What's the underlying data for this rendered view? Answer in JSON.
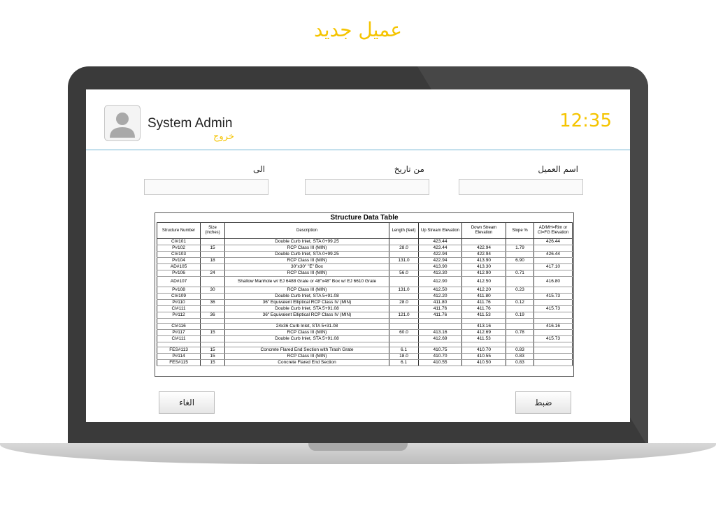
{
  "page_title": "عميل جديد",
  "header": {
    "username": "System Admin",
    "logout_label": "خروج",
    "time": "12:35"
  },
  "form": {
    "customer_name_label": "اسم العميل",
    "from_date_label": "من تاريخ",
    "to_label": "الى",
    "customer_name_value": "",
    "from_date_value": "",
    "to_value": ""
  },
  "document": {
    "title": "Structure Data Table",
    "columns": [
      "Structure Number",
      "Size (inches)",
      "Description",
      "Length (feet)",
      "Up Stream Elevation",
      "Down Stream Elevation",
      "Slope %",
      "AD/MH=Rim or CI=FG Elevation"
    ],
    "rows": [
      [
        "CI#101",
        "",
        "Double Curb Inlet, STA 0+99.25",
        "",
        "423.44",
        "",
        "",
        "426.44"
      ],
      [
        "P#102",
        "15",
        "RCP Class III (MIN)",
        "28.0",
        "423.44",
        "422.94",
        "1.79",
        ""
      ],
      [
        "CI#103",
        "",
        "Double Curb Inlet, STA 0+99.25",
        "",
        "422.94",
        "422.94",
        "",
        "426.44"
      ],
      [
        "P#104",
        "18",
        "RCP Class III (MIN)",
        "131.0",
        "422.94",
        "413.90",
        "6.90",
        ""
      ],
      [
        "AD#105",
        "",
        "30\"x30\" \"E\" Box",
        "",
        "413.90",
        "413.30",
        "",
        "417.10"
      ],
      [
        "P#106",
        "24",
        "RCP Class III (MIN)",
        "56.0",
        "413.30",
        "412.90",
        "0.71",
        ""
      ],
      [
        "AD#107",
        "",
        "Shallow Manhole w/ EJ 6488 Grate or 48\"x48\" Box w/ EJ 6610 Grate",
        "",
        "412.90",
        "412.50",
        "",
        "416.80"
      ],
      [
        "P#108",
        "30",
        "RCP Class III (MIN)",
        "131.0",
        "412.50",
        "412.20",
        "0.23",
        ""
      ],
      [
        "CI#109",
        "",
        "Double Curb Inlet, STA 5+91.08",
        "",
        "412.20",
        "411.80",
        "",
        "415.73"
      ],
      [
        "P#110",
        "36",
        "36\" Equivalent Elliptical RCP Class IV (MIN)",
        "28.0",
        "411.80",
        "411.76",
        "0.12",
        ""
      ],
      [
        "CI#111",
        "",
        "Double Curb Inlet, STA 5+91.08",
        "",
        "411.76",
        "411.76",
        "",
        "415.73"
      ],
      [
        "P#112",
        "36",
        "36\" Equivalent Elliptical RCP Class IV (MIN)",
        "121.0",
        "411.76",
        "411.53",
        "0.19",
        ""
      ],
      [
        "",
        "",
        "",
        "",
        "",
        "",
        "",
        ""
      ],
      [
        "CI#116",
        "",
        "24x36 Curb Inlet, STA 5+31.08",
        "",
        "",
        "413.16",
        "",
        "416.16"
      ],
      [
        "P#117",
        "15",
        "RCP Class III (MIN)",
        "60.0",
        "413.16",
        "412.69",
        "0.78",
        ""
      ],
      [
        "CI#111",
        "",
        "Double Curb Inlet, STA 5+91.08",
        "",
        "412.69",
        "411.53",
        "",
        "415.73"
      ],
      [
        "",
        "",
        "",
        "",
        "",
        "",
        "",
        ""
      ],
      [
        "FES#113",
        "15",
        "Concrete Flared End Section with Trash Grate",
        "6.1",
        "410.75",
        "410.70",
        "0.83",
        ""
      ],
      [
        "P#114",
        "15",
        "RCP Class III (MIN)",
        "18.0",
        "410.70",
        "410.55",
        "0.83",
        ""
      ],
      [
        "FES#115",
        "15",
        "Concrete Flared End Section",
        "6.1",
        "410.55",
        "410.50",
        "0.83",
        ""
      ]
    ]
  },
  "buttons": {
    "cancel_label": "الغاء",
    "submit_label": "ضبط"
  },
  "colors": {
    "accent": "#f5c400",
    "divider": "#6fb3d2",
    "laptop_body": "#3a3a3a"
  }
}
